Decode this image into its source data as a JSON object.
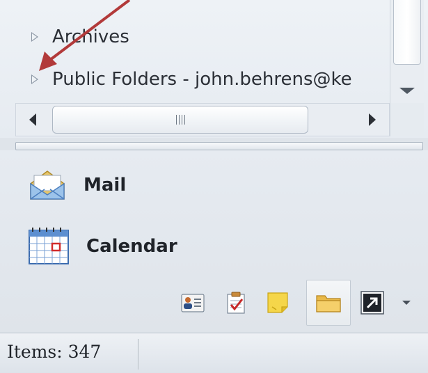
{
  "folder_pane": {
    "items": [
      {
        "label": "Archives"
      },
      {
        "label": "Public Folders - john.behrens@ke"
      }
    ]
  },
  "navigation": {
    "mail_label": "Mail",
    "calendar_label": "Calendar",
    "shortcuts": [
      {
        "icon": "contacts-icon"
      },
      {
        "icon": "tasks-icon"
      },
      {
        "icon": "notes-icon"
      },
      {
        "icon": "folder-list-icon",
        "selected": true
      },
      {
        "icon": "shortcuts-icon"
      },
      {
        "icon": "configure-buttons-chevron-icon"
      }
    ]
  },
  "status_bar": {
    "items_text": "Items: 347"
  },
  "colors": {
    "annotation_arrow": "#b23a3a",
    "accent_blue": "#3b6fb6"
  }
}
